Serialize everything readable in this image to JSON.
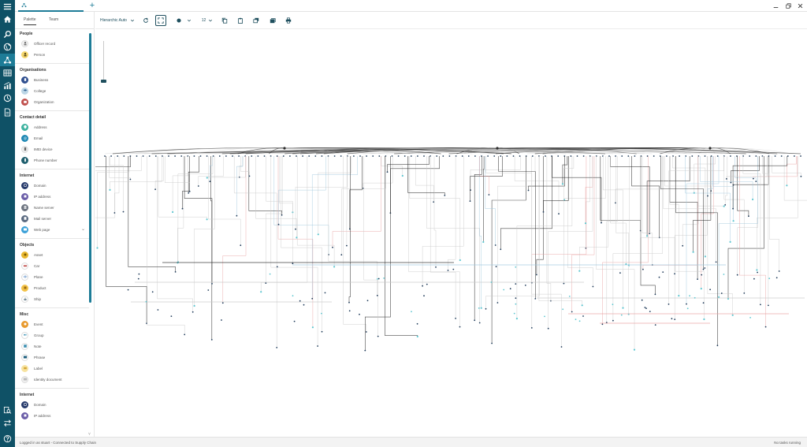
{
  "window": {
    "tab_title": "",
    "add_tab_label": "+"
  },
  "panel": {
    "tabs": [
      {
        "label": "Palette",
        "active": true
      },
      {
        "label": "Team",
        "active": false
      }
    ],
    "sections": [
      {
        "title": "People",
        "items": [
          {
            "label": "Officer record",
            "icon": "officer-icon",
            "color": "#f2f2f2"
          },
          {
            "label": "Person",
            "icon": "person-icon",
            "color": "#f5d76e"
          }
        ]
      },
      {
        "title": "Organisations",
        "items": [
          {
            "label": "Business",
            "icon": "business-icon",
            "color": "#2f4f8f"
          },
          {
            "label": "College",
            "icon": "college-icon",
            "color": "#bcd6e6"
          },
          {
            "label": "Organization",
            "icon": "organization-icon",
            "color": "#c0504d"
          }
        ]
      },
      {
        "title": "Contact detail",
        "items": [
          {
            "label": "Address",
            "icon": "address-icon",
            "color": "#3fb3a0"
          },
          {
            "label": "Email",
            "icon": "email-icon",
            "color": "#1e88b4"
          },
          {
            "label": "IMEI device",
            "icon": "device-icon",
            "color": "#efefef"
          },
          {
            "label": "Phone number",
            "icon": "phone-icon",
            "color": "#1f5f6e"
          }
        ]
      },
      {
        "title": "Internet",
        "items": [
          {
            "label": "Domain",
            "icon": "domain-icon",
            "color": "#263a6b"
          },
          {
            "label": "IP address",
            "icon": "ip-address-icon",
            "color": "#6b5ea8"
          },
          {
            "label": "Name server",
            "icon": "name-server-icon",
            "color": "#6d7480"
          },
          {
            "label": "Mail server",
            "icon": "mail-server-icon",
            "color": "#5a6a80"
          },
          {
            "label": "Web page",
            "icon": "web-page-icon",
            "color": "#3aa0d8"
          }
        ]
      },
      {
        "title": "Objects",
        "items": [
          {
            "label": "Asset",
            "icon": "asset-icon",
            "color": "#e8b730"
          },
          {
            "label": "Car",
            "icon": "car-icon",
            "color": "#ffffff"
          },
          {
            "label": "Plane",
            "icon": "plane-icon",
            "color": "#ffffff"
          },
          {
            "label": "Product",
            "icon": "product-icon",
            "color": "#f3c34a"
          },
          {
            "label": "Ship",
            "icon": "ship-icon",
            "color": "#ffffff"
          }
        ]
      },
      {
        "title": "Misc",
        "items": [
          {
            "label": "Event",
            "icon": "event-icon",
            "color": "#e89a2e"
          },
          {
            "label": "Group",
            "icon": "group-icon",
            "color": "#ffffff"
          },
          {
            "label": "Note",
            "icon": "note-icon",
            "color": "#ffffff"
          },
          {
            "label": "Phrase",
            "icon": "phrase-icon",
            "color": "#ffffff"
          },
          {
            "label": "Label",
            "icon": "label-icon",
            "color": "#f7e3a0"
          },
          {
            "label": "Identity document",
            "icon": "identity-document-icon",
            "color": "#f0f0f0"
          }
        ]
      },
      {
        "title": "Internet",
        "items": [
          {
            "label": "Domain",
            "icon": "domain-icon",
            "color": "#263a6b"
          },
          {
            "label": "IP address",
            "icon": "ip-address-icon",
            "color": "#6b5ea8"
          }
        ]
      }
    ]
  },
  "toolbar": {
    "layout_label": "Hierarchic Auto",
    "size_value": "12"
  },
  "status": {
    "left": "Logged in as stuart - Connected to Supply Chain",
    "right": "No tasks running"
  },
  "colors": {
    "rail": "#0f5166",
    "accent": "#1d7c97",
    "edge_dark": "#2b2b2b",
    "edge_light": "#c8c8c8",
    "edge_red": "#e8a0a0",
    "edge_blue": "#9ec7dd",
    "node_dark": "#1f3b5a",
    "node_teal": "#5fc7d1"
  }
}
